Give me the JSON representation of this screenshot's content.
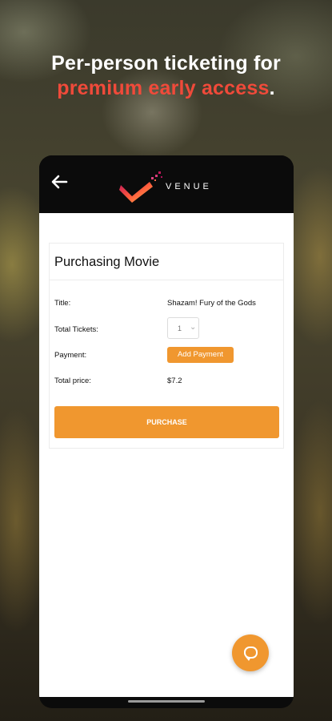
{
  "headline": {
    "line1": "Per-person ticketing for",
    "accent": "premium early access",
    "dot": "."
  },
  "app": {
    "brand": "VENUE",
    "back_icon": "back-arrow-icon"
  },
  "card": {
    "title": "Purchasing Movie",
    "rows": {
      "title_label": "Title:",
      "title_value": "Shazam! Fury of the Gods",
      "tickets_label": "Total Tickets:",
      "tickets_value": "1",
      "payment_label": "Payment:",
      "payment_button": "Add Payment",
      "price_label": "Total price:",
      "price_value": "$7.2"
    },
    "purchase_button": "PURCHASE"
  },
  "colors": {
    "accent_orange": "#f0972f",
    "headline_accent": "#f04a3a"
  },
  "fab": {
    "icon": "chat-support-icon"
  }
}
